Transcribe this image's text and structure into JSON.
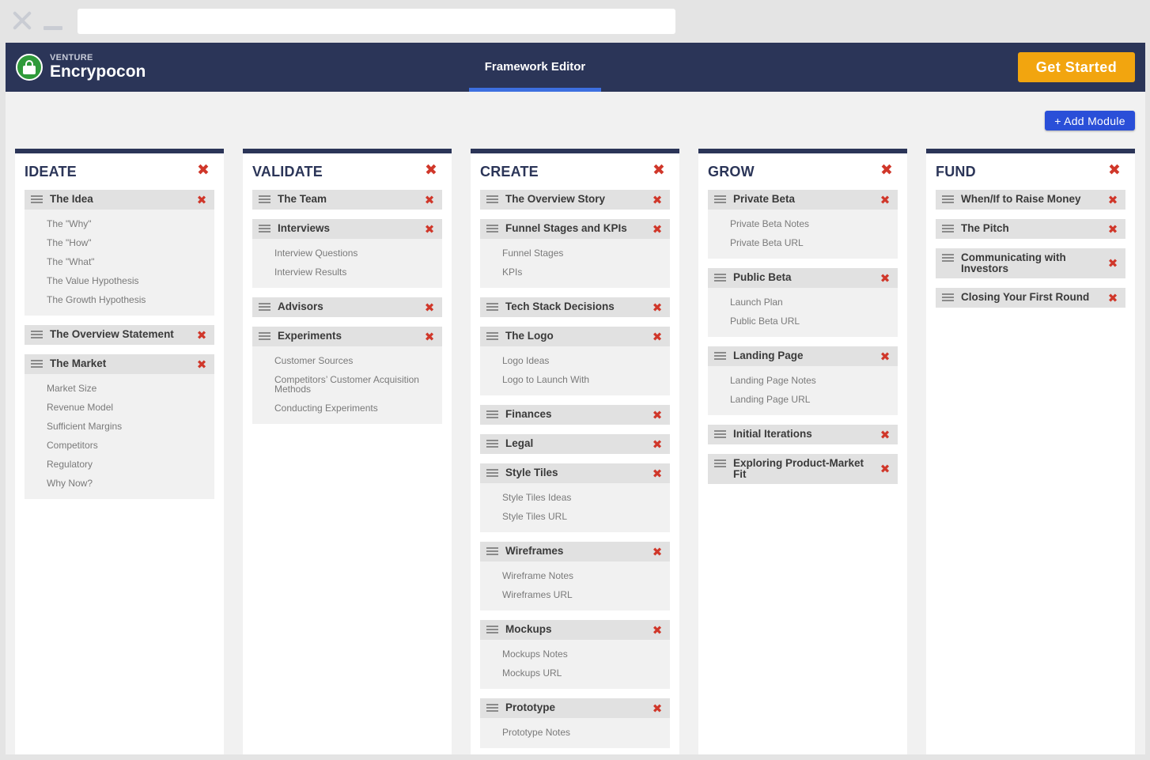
{
  "brand": {
    "sub": "VENTURE",
    "name": "Encrypocon"
  },
  "nav": {
    "active_tab": "Framework Editor"
  },
  "actions": {
    "get_started": "Get Started",
    "add_module": "+ Add Module"
  },
  "icons": {
    "close": "close-icon",
    "drag": "drag-handle-icon",
    "logo": "lock-icon"
  },
  "colors": {
    "header": "#2b3558",
    "accent": "#f2a50f",
    "primary": "#2a4fd8",
    "danger": "#d0372a",
    "logo_green": "#2f9a3a"
  },
  "columns": [
    {
      "title": "IDEATE",
      "modules": [
        {
          "title": "The Idea",
          "items": [
            "The \"Why\"",
            "The \"How\"",
            "The \"What\"",
            "The Value Hypothesis",
            "The Growth Hypothesis"
          ]
        },
        {
          "title": "The Overview Statement",
          "items": []
        },
        {
          "title": "The Market",
          "items": [
            "Market Size",
            "Revenue Model",
            "Sufficient Margins",
            "Competitors",
            "Regulatory",
            "Why Now?"
          ]
        }
      ]
    },
    {
      "title": "VALIDATE",
      "modules": [
        {
          "title": "The Team",
          "items": []
        },
        {
          "title": "Interviews",
          "items": [
            "Interview Questions",
            "Interview Results"
          ]
        },
        {
          "title": "Advisors",
          "items": []
        },
        {
          "title": "Experiments",
          "items": [
            "Customer Sources",
            "Competitors’ Customer Acquisition Methods",
            "Conducting Experiments"
          ]
        }
      ]
    },
    {
      "title": "CREATE",
      "modules": [
        {
          "title": "The Overview Story",
          "items": []
        },
        {
          "title": "Funnel Stages and KPIs",
          "items": [
            "Funnel Stages",
            "KPIs"
          ]
        },
        {
          "title": "Tech Stack Decisions",
          "items": []
        },
        {
          "title": "The Logo",
          "items": [
            "Logo Ideas",
            "Logo to Launch With"
          ]
        },
        {
          "title": "Finances",
          "items": []
        },
        {
          "title": "Legal",
          "items": []
        },
        {
          "title": "Style Tiles",
          "items": [
            "Style Tiles Ideas",
            "Style Tiles URL"
          ]
        },
        {
          "title": "Wireframes",
          "items": [
            "Wireframe Notes",
            "Wireframes URL"
          ]
        },
        {
          "title": "Mockups",
          "items": [
            "Mockups Notes",
            "Mockups URL"
          ]
        },
        {
          "title": "Prototype",
          "items": [
            "Prototype Notes"
          ]
        }
      ]
    },
    {
      "title": "GROW",
      "modules": [
        {
          "title": "Private Beta",
          "items": [
            "Private Beta Notes",
            "Private Beta URL"
          ]
        },
        {
          "title": "Public Beta",
          "items": [
            "Launch Plan",
            "Public Beta URL"
          ]
        },
        {
          "title": "Landing Page",
          "items": [
            "Landing Page Notes",
            "Landing Page URL"
          ]
        },
        {
          "title": "Initial Iterations",
          "items": []
        },
        {
          "title": "Exploring Product-Market Fit",
          "items": []
        }
      ]
    },
    {
      "title": "FUND",
      "modules": [
        {
          "title": "When/If to Raise Money",
          "items": []
        },
        {
          "title": "The Pitch",
          "items": []
        },
        {
          "title": "Communicating with Investors",
          "items": []
        },
        {
          "title": "Closing Your First Round",
          "items": []
        }
      ]
    }
  ]
}
